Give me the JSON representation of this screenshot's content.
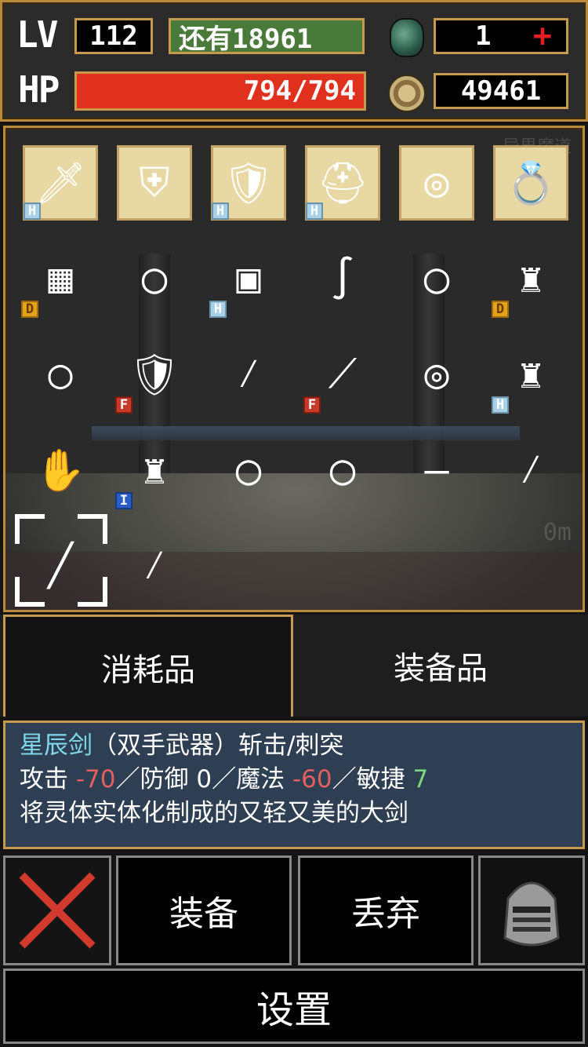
{
  "header": {
    "lv_label": "LV",
    "lv_value": "112",
    "exp_remaining": "还有18961",
    "hp_label": "HP",
    "hp_current": 794,
    "hp_max": 794,
    "hp_text": "794/794",
    "gem_count": "1",
    "gem_plus": "+",
    "gold": "49461",
    "hp_color": "#e0311e"
  },
  "inventory": {
    "watermark": "异界魔道",
    "depth": "0m",
    "equipped": [
      {
        "icon": "sword-icon",
        "glyph": "🗡",
        "badge": "H"
      },
      {
        "icon": "shield-slot-icon",
        "glyph": "⛨",
        "badge": ""
      },
      {
        "icon": "armor-icon",
        "glyph": "🛡",
        "badge": "H"
      },
      {
        "icon": "helmet-icon",
        "glyph": "⛑",
        "badge": "H"
      },
      {
        "icon": "bracelet-icon",
        "glyph": "◎",
        "badge": ""
      },
      {
        "icon": "ring-icon",
        "glyph": "💍",
        "badge": ""
      }
    ],
    "items_row1": [
      {
        "icon": "scale-armor-icon",
        "glyph": "▦",
        "badge": "D"
      },
      {
        "icon": "ring-icon",
        "glyph": "◯",
        "badge": ""
      },
      {
        "icon": "iron-bracelet-icon",
        "glyph": "▣",
        "badge": "H"
      },
      {
        "icon": "whip-icon",
        "glyph": "∫",
        "badge": ""
      },
      {
        "icon": "ring-icon",
        "glyph": "◯",
        "badge": ""
      },
      {
        "icon": "green-armor-icon",
        "glyph": "♜",
        "badge": "D"
      }
    ],
    "items_row2": [
      {
        "icon": "silver-ring-icon",
        "glyph": "○",
        "badge": ""
      },
      {
        "icon": "flame-shield-icon",
        "glyph": "🛡",
        "badge": "F"
      },
      {
        "icon": "staff-icon",
        "glyph": "⁄",
        "badge": ""
      },
      {
        "icon": "spear-icon",
        "glyph": "⟋",
        "badge": "F"
      },
      {
        "icon": "bracelet-icon",
        "glyph": "◎",
        "badge": ""
      },
      {
        "icon": "plate-armor-icon",
        "glyph": "♜",
        "badge": "H"
      }
    ],
    "items_row3": [
      {
        "icon": "gauntlet-icon",
        "glyph": "✋",
        "badge": ""
      },
      {
        "icon": "blue-armor-icon",
        "glyph": "♜",
        "badge": "I"
      },
      {
        "icon": "ring-icon",
        "glyph": "◯",
        "badge": ""
      },
      {
        "icon": "ring-icon",
        "glyph": "◯",
        "badge": ""
      },
      {
        "icon": "dagger-icon",
        "glyph": "—",
        "badge": ""
      },
      {
        "icon": "staff-icon",
        "glyph": "⁄",
        "badge": ""
      }
    ],
    "items_row4": [
      {
        "icon": "star-sword-icon",
        "glyph": "╱",
        "badge": ""
      },
      {
        "icon": "wand-icon",
        "glyph": "⁄",
        "badge": ""
      }
    ]
  },
  "tabs": {
    "consumables": "消耗品",
    "equipment": "装备品"
  },
  "description": {
    "name": "星辰剑",
    "type": "（双手武器）斩击/刺突",
    "atk_label": "攻击",
    "atk_value": "-70",
    "def_label": "／防御",
    "def_value": "0",
    "mag_label": "／魔法",
    "mag_value": "-60",
    "agi_label": "／敏捷",
    "agi_value": "7",
    "flavor": "将灵体实体化制成的又轻又美的大剑"
  },
  "actions": {
    "equip": "装备",
    "discard": "丢弃",
    "settings": "设置"
  }
}
